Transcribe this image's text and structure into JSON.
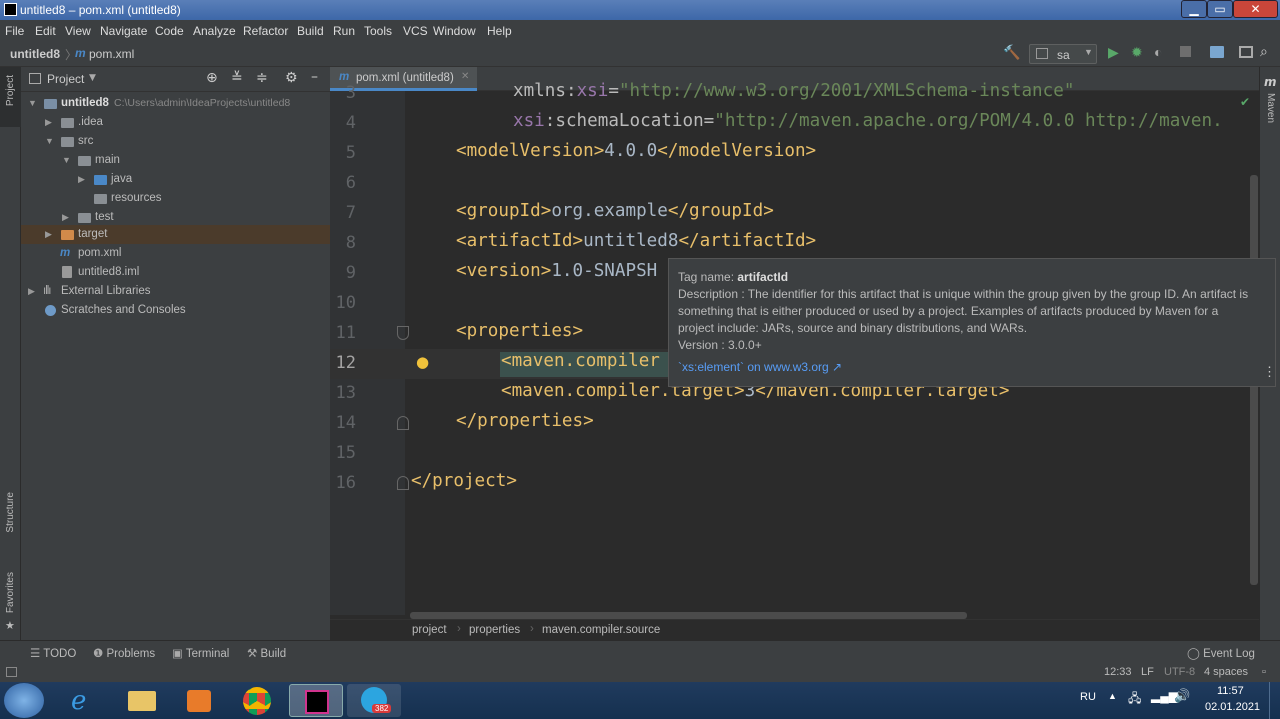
{
  "window": {
    "title": "untitled8 – pom.xml (untitled8)"
  },
  "menu": [
    "File",
    "Edit",
    "View",
    "Navigate",
    "Code",
    "Analyze",
    "Refactor",
    "Build",
    "Run",
    "Tools",
    "VCS",
    "Window",
    "Help"
  ],
  "navbar": {
    "project": "untitled8",
    "file": "pom.xml",
    "run_config": "sa"
  },
  "sidebar_left": {
    "project_tab": "Project",
    "structure_tab": "Structure",
    "favorites_tab": "Favorites"
  },
  "sidebar_right": {
    "maven_tab": "Maven"
  },
  "project_panel": {
    "title": "Project",
    "tree": [
      {
        "label": "untitled8",
        "path": "C:\\Users\\admin\\IdeaProjects\\untitled8"
      },
      {
        "label": ".idea"
      },
      {
        "label": "src"
      },
      {
        "label": "main"
      },
      {
        "label": "java"
      },
      {
        "label": "resources"
      },
      {
        "label": "test"
      },
      {
        "label": "target"
      },
      {
        "label": "pom.xml"
      },
      {
        "label": "untitled8.iml"
      },
      {
        "label": "External Libraries"
      },
      {
        "label": "Scratches and Consoles"
      }
    ]
  },
  "editor": {
    "tab_label": "pom.xml (untitled8)",
    "line_numbers": [
      "3",
      "4",
      "5",
      "6",
      "7",
      "8",
      "9",
      "10",
      "11",
      "12",
      "13",
      "14",
      "15",
      "16"
    ],
    "lines": {
      "l3_open": "xmlns:",
      "l3_ns": "xsi",
      "l3_eq": "=",
      "l3_val": "\"http://www.w3.org/2001/XMLSchema-instance\"",
      "l4_ns": "xsi",
      "l4_attr": ":schemaLocation=",
      "l4_val": "\"http://maven.apache.org/POM/4.0.0 http://maven.",
      "l5_open": "<modelVersion>",
      "l5_text": "4.0.0",
      "l5_close": "</modelVersion>",
      "l7_open": "<groupId>",
      "l7_text": "org.example",
      "l7_close": "</groupId>",
      "l8_open": "<artifactId>",
      "l8_text": "untitled8",
      "l8_close": "</artifactId>",
      "l9_open": "<version>",
      "l9_text": "1.0-SNAPSH",
      "l11_open": "<properties>",
      "l12_open": "<maven.compiler",
      "l13_open": "<maven.compiler.target>",
      "l13_text": "3",
      "l13_close": "</maven.compiler.target>",
      "l14_close": "</properties>",
      "l16_close": "</project>"
    }
  },
  "popup": {
    "tag_label": "Tag name: ",
    "tag_name": "artifactId",
    "description": "Description : The identifier for this artifact that is unique within the group given by the group ID. An artifact is something that is either produced or used by a project. Examples of artifacts produced by Maven for a project include: JARs, source and binary distributions, and WARs.",
    "version": "Version : 3.0.0+",
    "link": "`xs:element` on www.w3.org ↗"
  },
  "breadcrumb": [
    "project",
    "properties",
    "maven.compiler.source"
  ],
  "toolwindows": {
    "todo": "TODO",
    "problems": "Problems",
    "terminal": "Terminal",
    "build": "Build",
    "event_log": "Event Log"
  },
  "status": {
    "position": "12:33",
    "line_sep": "LF",
    "encoding": "UTF-8",
    "indent": "4 spaces"
  },
  "taskbar": {
    "lang": "RU",
    "time": "11:57",
    "date": "02.01.2021",
    "badge": "382"
  },
  "colors": {
    "accent": "#4a88c7",
    "tag": "#e8bf6a",
    "string": "#6a8759",
    "namespace": "#9876aa"
  }
}
